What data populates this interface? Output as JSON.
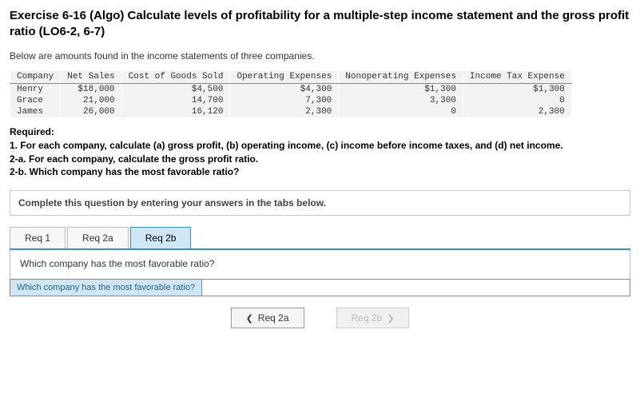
{
  "title": "Exercise 6-16 (Algo) Calculate levels of profitability for a multiple-step income statement and the gross profit ratio (LO6-2, 6-7)",
  "intro": "Below are amounts found in the income statements of three companies.",
  "table": {
    "headers": [
      "Company",
      "Net Sales",
      "Cost of Goods Sold",
      "Operating Expenses",
      "Nonoperating Expenses",
      "Income Tax Expense"
    ],
    "rows": [
      {
        "company": "Henry",
        "net_sales": "$18,000",
        "cogs": "$4,500",
        "op_exp": "$4,300",
        "nonop": "$1,300",
        "tax": "$1,300"
      },
      {
        "company": "Grace",
        "net_sales": "21,000",
        "cogs": "14,700",
        "op_exp": "7,300",
        "nonop": "3,300",
        "tax": "0"
      },
      {
        "company": "James",
        "net_sales": "26,000",
        "cogs": "16,120",
        "op_exp": "2,300",
        "nonop": "0",
        "tax": "2,300"
      }
    ]
  },
  "required": {
    "heading": "Required:",
    "line1": "1. For each company, calculate (a) gross profit, (b) operating income, (c) income before income taxes, and (d) net income.",
    "line2": "2-a. For each company, calculate the gross profit ratio.",
    "line3": "2-b. Which company has the most favorable ratio?"
  },
  "instruction": "Complete this question by entering your answers in the tabs below.",
  "tabs": {
    "req1": "Req 1",
    "req2a": "Req 2a",
    "req2b": "Req 2b"
  },
  "question": "Which company has the most favorable ratio?",
  "answer_label": "Which company has the most favorable ratio?",
  "answer_value": "",
  "nav": {
    "prev": "Req 2a",
    "next": "Req 2b"
  }
}
